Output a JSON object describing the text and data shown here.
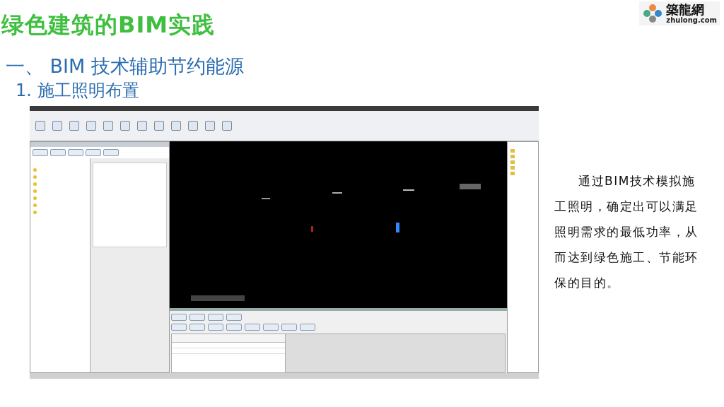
{
  "slide": {
    "title": "绿色建筑的BIM实践",
    "logo": {
      "name": "築龍網",
      "url": "zhulong.com"
    },
    "heading": "一、 BIM 技术辅助节约能源",
    "subheading": "1.  施工照明布置",
    "paragraph": "通过BIM技术模拟施工照明，确定出可以满足照明需求的最低功率，从而达到绿色施工、节能环保的目的。"
  }
}
